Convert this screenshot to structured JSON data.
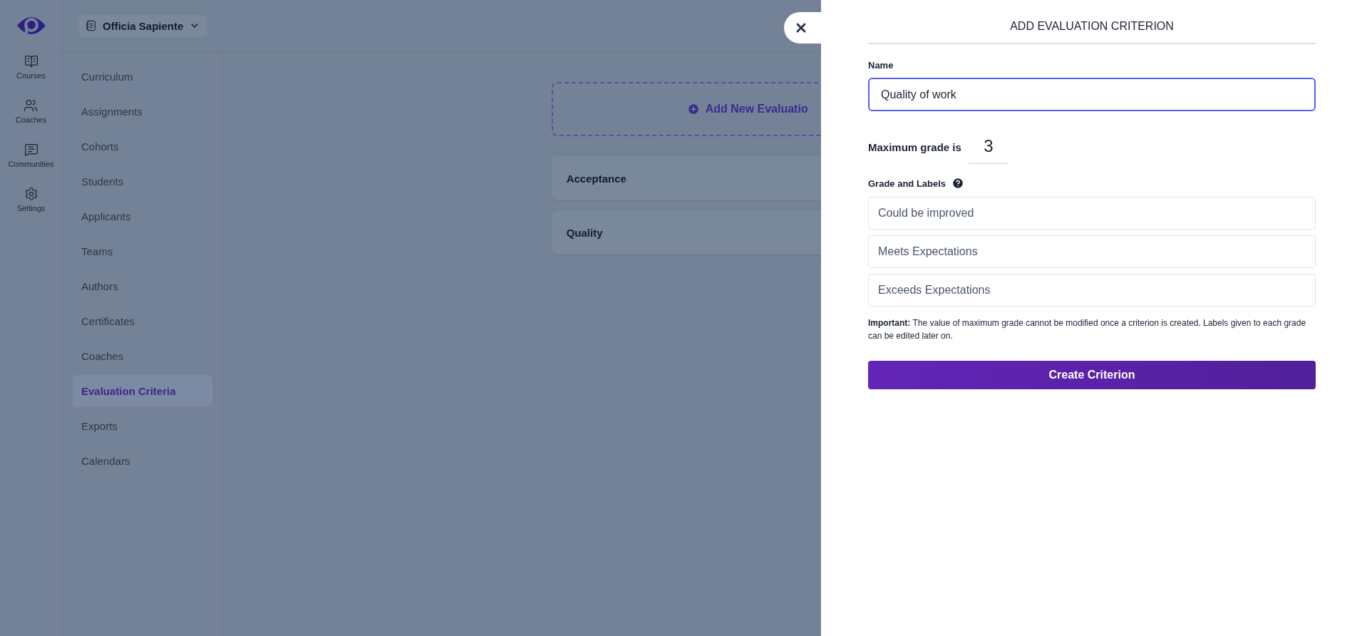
{
  "rail": [
    {
      "label": "Courses"
    },
    {
      "label": "Coaches"
    },
    {
      "label": "Communities"
    },
    {
      "label": "Settings"
    }
  ],
  "header": {
    "school": "Officia Sapiente"
  },
  "sidebar": {
    "items": [
      {
        "label": "Curriculum",
        "selected": false
      },
      {
        "label": "Assignments",
        "selected": false
      },
      {
        "label": "Cohorts",
        "selected": false
      },
      {
        "label": "Students",
        "selected": false
      },
      {
        "label": "Applicants",
        "selected": false
      },
      {
        "label": "Teams",
        "selected": false
      },
      {
        "label": "Authors",
        "selected": false
      },
      {
        "label": "Certificates",
        "selected": false
      },
      {
        "label": "Coaches",
        "selected": false
      },
      {
        "label": "Evaluation Criteria",
        "selected": true
      },
      {
        "label": "Exports",
        "selected": false
      },
      {
        "label": "Calendars",
        "selected": false
      }
    ]
  },
  "main": {
    "add_button": "Add New Evaluatio",
    "criteria": [
      "Acceptance",
      "Quality"
    ]
  },
  "panel": {
    "title": "ADD EVALUATION CRITERION",
    "name_label": "Name",
    "name_value": "Quality of work",
    "max_grade_label": "Maximum grade is",
    "max_grade": "3",
    "labels_heading": "Grade and Labels",
    "grade_labels": [
      "Could be improved",
      "Meets Expectations",
      "Exceeds Expectations"
    ],
    "note_bold": "Important:",
    "note": "The value of maximum grade cannot be modified once a criterion is created. Labels given to each grade can be edited later on.",
    "submit": "Create Criterion"
  }
}
